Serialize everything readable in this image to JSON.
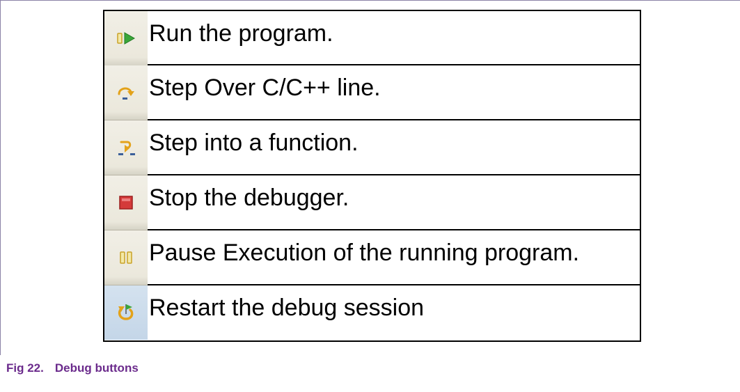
{
  "rows": [
    {
      "icon": "resume-icon",
      "label": "Run the program."
    },
    {
      "icon": "step-over-icon",
      "label": "Step Over C/C++ line."
    },
    {
      "icon": "step-into-icon",
      "label": "Step into a function."
    },
    {
      "icon": "stop-icon",
      "label": "Stop the debugger."
    },
    {
      "icon": "pause-icon",
      "label": "Pause Execution of the running program."
    },
    {
      "icon": "restart-icon",
      "label": "Restart the debug session"
    }
  ],
  "caption": {
    "number": "Fig 22.",
    "title": "Debug buttons"
  },
  "colors": {
    "caption": "#6b2b8c",
    "run_green": "#3aa63a",
    "stop_red": "#d43a3a",
    "arrow_orange": "#e3a21a",
    "frame": "#8a82a6"
  }
}
